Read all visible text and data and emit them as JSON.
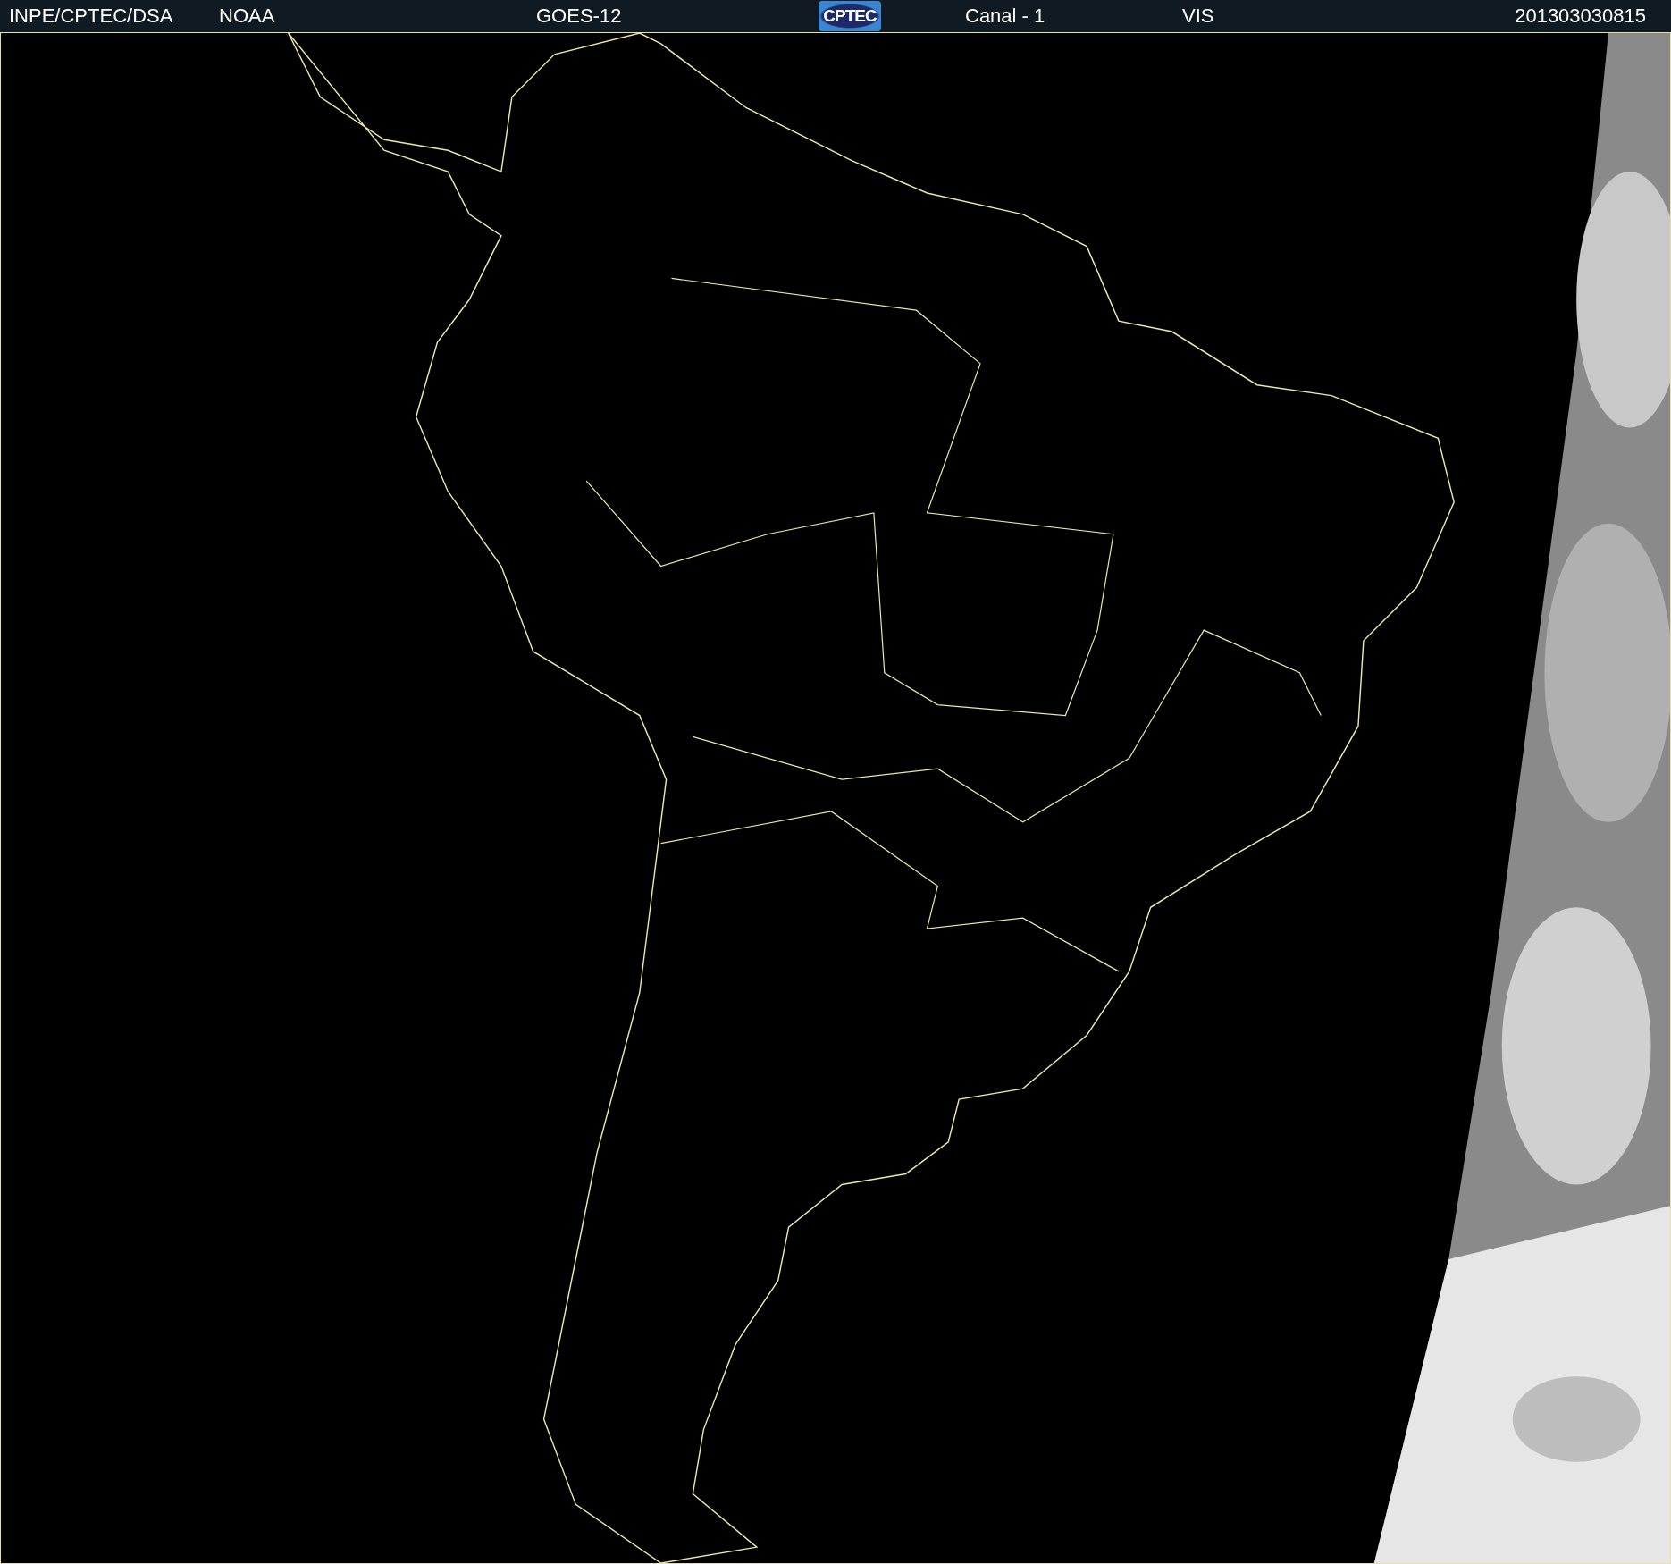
{
  "header": {
    "source": "INPE/CPTEC/DSA",
    "agency": "NOAA",
    "satellite": "GOES-12",
    "logo": "CPTEC",
    "channel": "Canal - 1",
    "band": "VIS",
    "timestamp": "201303030815"
  }
}
